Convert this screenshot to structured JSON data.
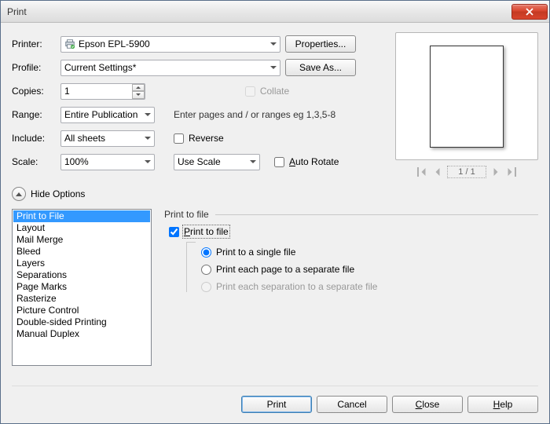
{
  "window": {
    "title": "Print"
  },
  "labels": {
    "printer": "Printer:",
    "profile": "Profile:",
    "copies": "Copies:",
    "range": "Range:",
    "include": "Include:",
    "scale": "Scale:"
  },
  "printer": {
    "name": "Epson EPL-5900"
  },
  "profile": {
    "name": "Current Settings*"
  },
  "copies": {
    "value": "1"
  },
  "collate": {
    "label": "Collate"
  },
  "range": {
    "value": "Entire Publication",
    "hint": "Enter pages and / or ranges eg 1,3,5-8"
  },
  "include": {
    "value": "All sheets"
  },
  "reverse": {
    "label": "Reverse"
  },
  "scale": {
    "value": "100%",
    "mode": "Use Scale"
  },
  "autorotate": {
    "prefix": "A",
    "rest": "uto Rotate"
  },
  "buttons": {
    "properties": "Properties...",
    "saveas": "Save As...",
    "print": "Print",
    "cancel": "Cancel",
    "close": {
      "prefix": "C",
      "rest": "lose"
    },
    "help": {
      "prefix": "H",
      "rest": "elp"
    }
  },
  "hide_options": "Hide Options",
  "preview": {
    "page_indicator": "1 / 1"
  },
  "options_list": [
    "Print to File",
    "Layout",
    "Mail Merge",
    "Bleed",
    "Layers",
    "Separations",
    "Page Marks",
    "Rasterize",
    "Picture Control",
    "Double-sided Printing",
    "Manual Duplex"
  ],
  "panel": {
    "title": "Print to file",
    "checkbox": {
      "prefix": "P",
      "rest": "rint to file"
    },
    "radios": {
      "single": "Print to a single file",
      "each_page": "Print each page to a separate file",
      "each_sep": "Print each separation to a separate file"
    }
  }
}
